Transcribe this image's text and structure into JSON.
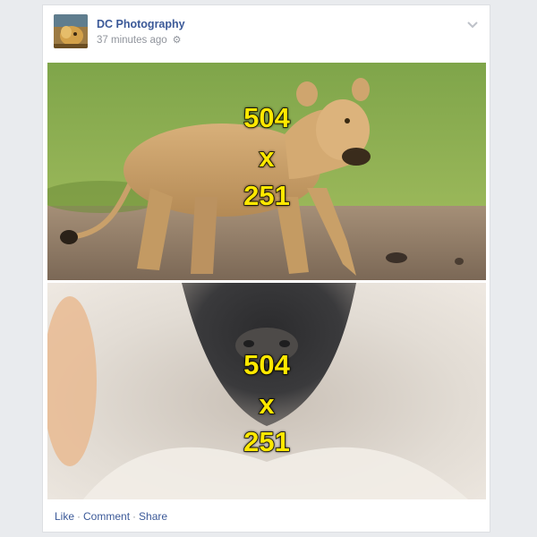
{
  "post": {
    "author": "DC Photography",
    "time": "37 minutes ago",
    "privacy_icon": "gear-icon",
    "menu_icon": "chevron-down-icon",
    "images": [
      {
        "subject": "lioness walking",
        "width_label": "504",
        "x_label": "x",
        "height_label": "251"
      },
      {
        "subject": "close-up animal nose",
        "width_label": "504",
        "x_label": "x",
        "height_label": "251"
      }
    ],
    "actions": {
      "like": "Like",
      "comment": "Comment",
      "share": "Share",
      "separator": "·"
    }
  },
  "colors": {
    "background": "#e9ebee",
    "link": "#3b5998",
    "meta_text": "#90949c",
    "overlay_text": "#ffe800"
  }
}
